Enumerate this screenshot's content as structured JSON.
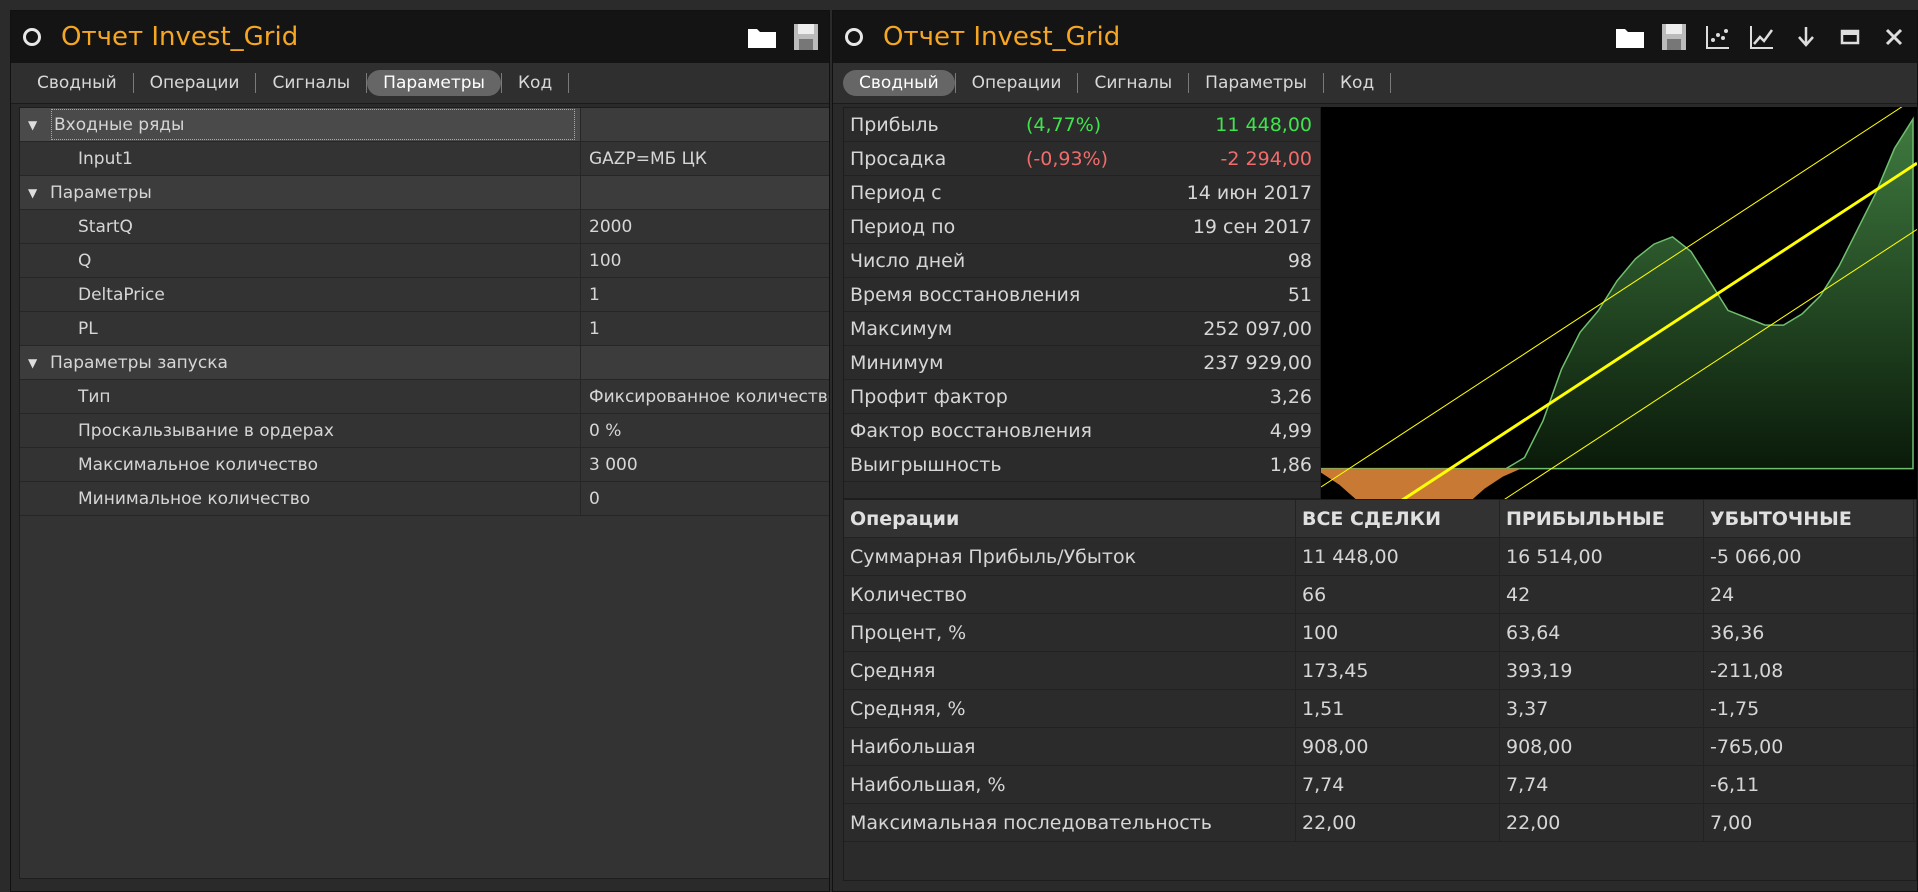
{
  "left": {
    "title": "Отчет Invest_Grid",
    "tabs": [
      "Сводный",
      "Операции",
      "Сигналы",
      "Параметры",
      "Код"
    ],
    "active_tab": "Параметры",
    "tree": {
      "groups": [
        {
          "label": "Входные ряды",
          "rows": [
            {
              "name": "Input1",
              "value": "GAZP=МБ ЦК"
            }
          ]
        },
        {
          "label": "Параметры",
          "rows": [
            {
              "name": "StartQ",
              "value": "2000"
            },
            {
              "name": "Q",
              "value": "100"
            },
            {
              "name": "DeltaPrice",
              "value": "1"
            },
            {
              "name": "PL",
              "value": "1"
            }
          ]
        },
        {
          "label": "Параметры запуска",
          "rows": [
            {
              "name": "Тип",
              "value": "Фиксированное количество"
            },
            {
              "name": "Проскальзывание в ордерах",
              "value": "0 %"
            },
            {
              "name": "Максимальное количество",
              "value": "3 000"
            },
            {
              "name": "Минимальное количество",
              "value": "0"
            }
          ]
        }
      ]
    }
  },
  "right": {
    "title": "Отчет Invest_Grid",
    "tabs": [
      "Сводный",
      "Операции",
      "Сигналы",
      "Параметры",
      "Код"
    ],
    "active_tab": "Сводный",
    "stats": [
      {
        "label": "Прибыль",
        "pct": "(4,77%)",
        "value": "11 448,00",
        "color": "green"
      },
      {
        "label": "Просадка",
        "pct": "(-0,93%)",
        "value": "-2 294,00",
        "color": "red"
      },
      {
        "label": "Период с",
        "pct": "",
        "value": "14 июн 2017",
        "color": ""
      },
      {
        "label": "Период по",
        "pct": "",
        "value": "19 сен 2017",
        "color": ""
      },
      {
        "label": "Число дней",
        "pct": "",
        "value": "98",
        "color": ""
      },
      {
        "label": "Время восстановления",
        "pct": "",
        "value": "51",
        "color": ""
      },
      {
        "label": "Максимум",
        "pct": "",
        "value": "252 097,00",
        "color": ""
      },
      {
        "label": "Минимум",
        "pct": "",
        "value": "237 929,00",
        "color": ""
      },
      {
        "label": "Профит фактор",
        "pct": "",
        "value": "3,26",
        "color": ""
      },
      {
        "label": "Фактор восстановления",
        "pct": "",
        "value": "4,99",
        "color": ""
      },
      {
        "label": "Выигрышность",
        "pct": "",
        "value": "1,86",
        "color": ""
      }
    ],
    "ops": {
      "headers": [
        "Операции",
        "ВСЕ СДЕЛКИ",
        "ПРИБЫЛЬНЫЕ",
        "УБЫТОЧНЫЕ"
      ],
      "rows": [
        [
          "Суммарная Прибыль/Убыток",
          "11 448,00",
          "16 514,00",
          "-5 066,00"
        ],
        [
          "Количество",
          "66",
          "42",
          "24"
        ],
        [
          "Процент, %",
          "100",
          "63,64",
          "36,36"
        ],
        [
          "Средняя",
          "173,45",
          "393,19",
          "-211,08"
        ],
        [
          "Средняя, %",
          "1,51",
          "3,37",
          "-1,75"
        ],
        [
          "Наибольшая",
          "908,00",
          "908,00",
          "-765,00"
        ],
        [
          "Наибольшая, %",
          "7,74",
          "7,74",
          "-6,11"
        ],
        [
          "Максимальная последовательность",
          "22,00",
          "22,00",
          "7,00"
        ]
      ]
    }
  },
  "colors": {
    "title": "#f5a623",
    "profit": "#3fe34d",
    "loss": "#f06b6b",
    "regression": "#ffff00",
    "equity_fill": "#2f5a2f",
    "drawdown_fill": "#c87a35"
  },
  "chart_data": {
    "type": "area",
    "equity": [
      0.05,
      0.05,
      0.05,
      0.05,
      0.05,
      0.05,
      0.05,
      0.05,
      0.05,
      0.05,
      0.05,
      0.08,
      0.18,
      0.32,
      0.42,
      0.48,
      0.56,
      0.62,
      0.66,
      0.68,
      0.64,
      0.56,
      0.48,
      0.46,
      0.44,
      0.44,
      0.47,
      0.52,
      0.6,
      0.7,
      0.8,
      0.92,
      1.0
    ],
    "drawdown": [
      0.02,
      0.08,
      0.16,
      0.22,
      0.26,
      0.28,
      0.27,
      0.24,
      0.18,
      0.1,
      0.04,
      0.0
    ],
    "regression": {
      "start": -0.18,
      "end": 0.88
    },
    "channel_offset": 0.18
  }
}
